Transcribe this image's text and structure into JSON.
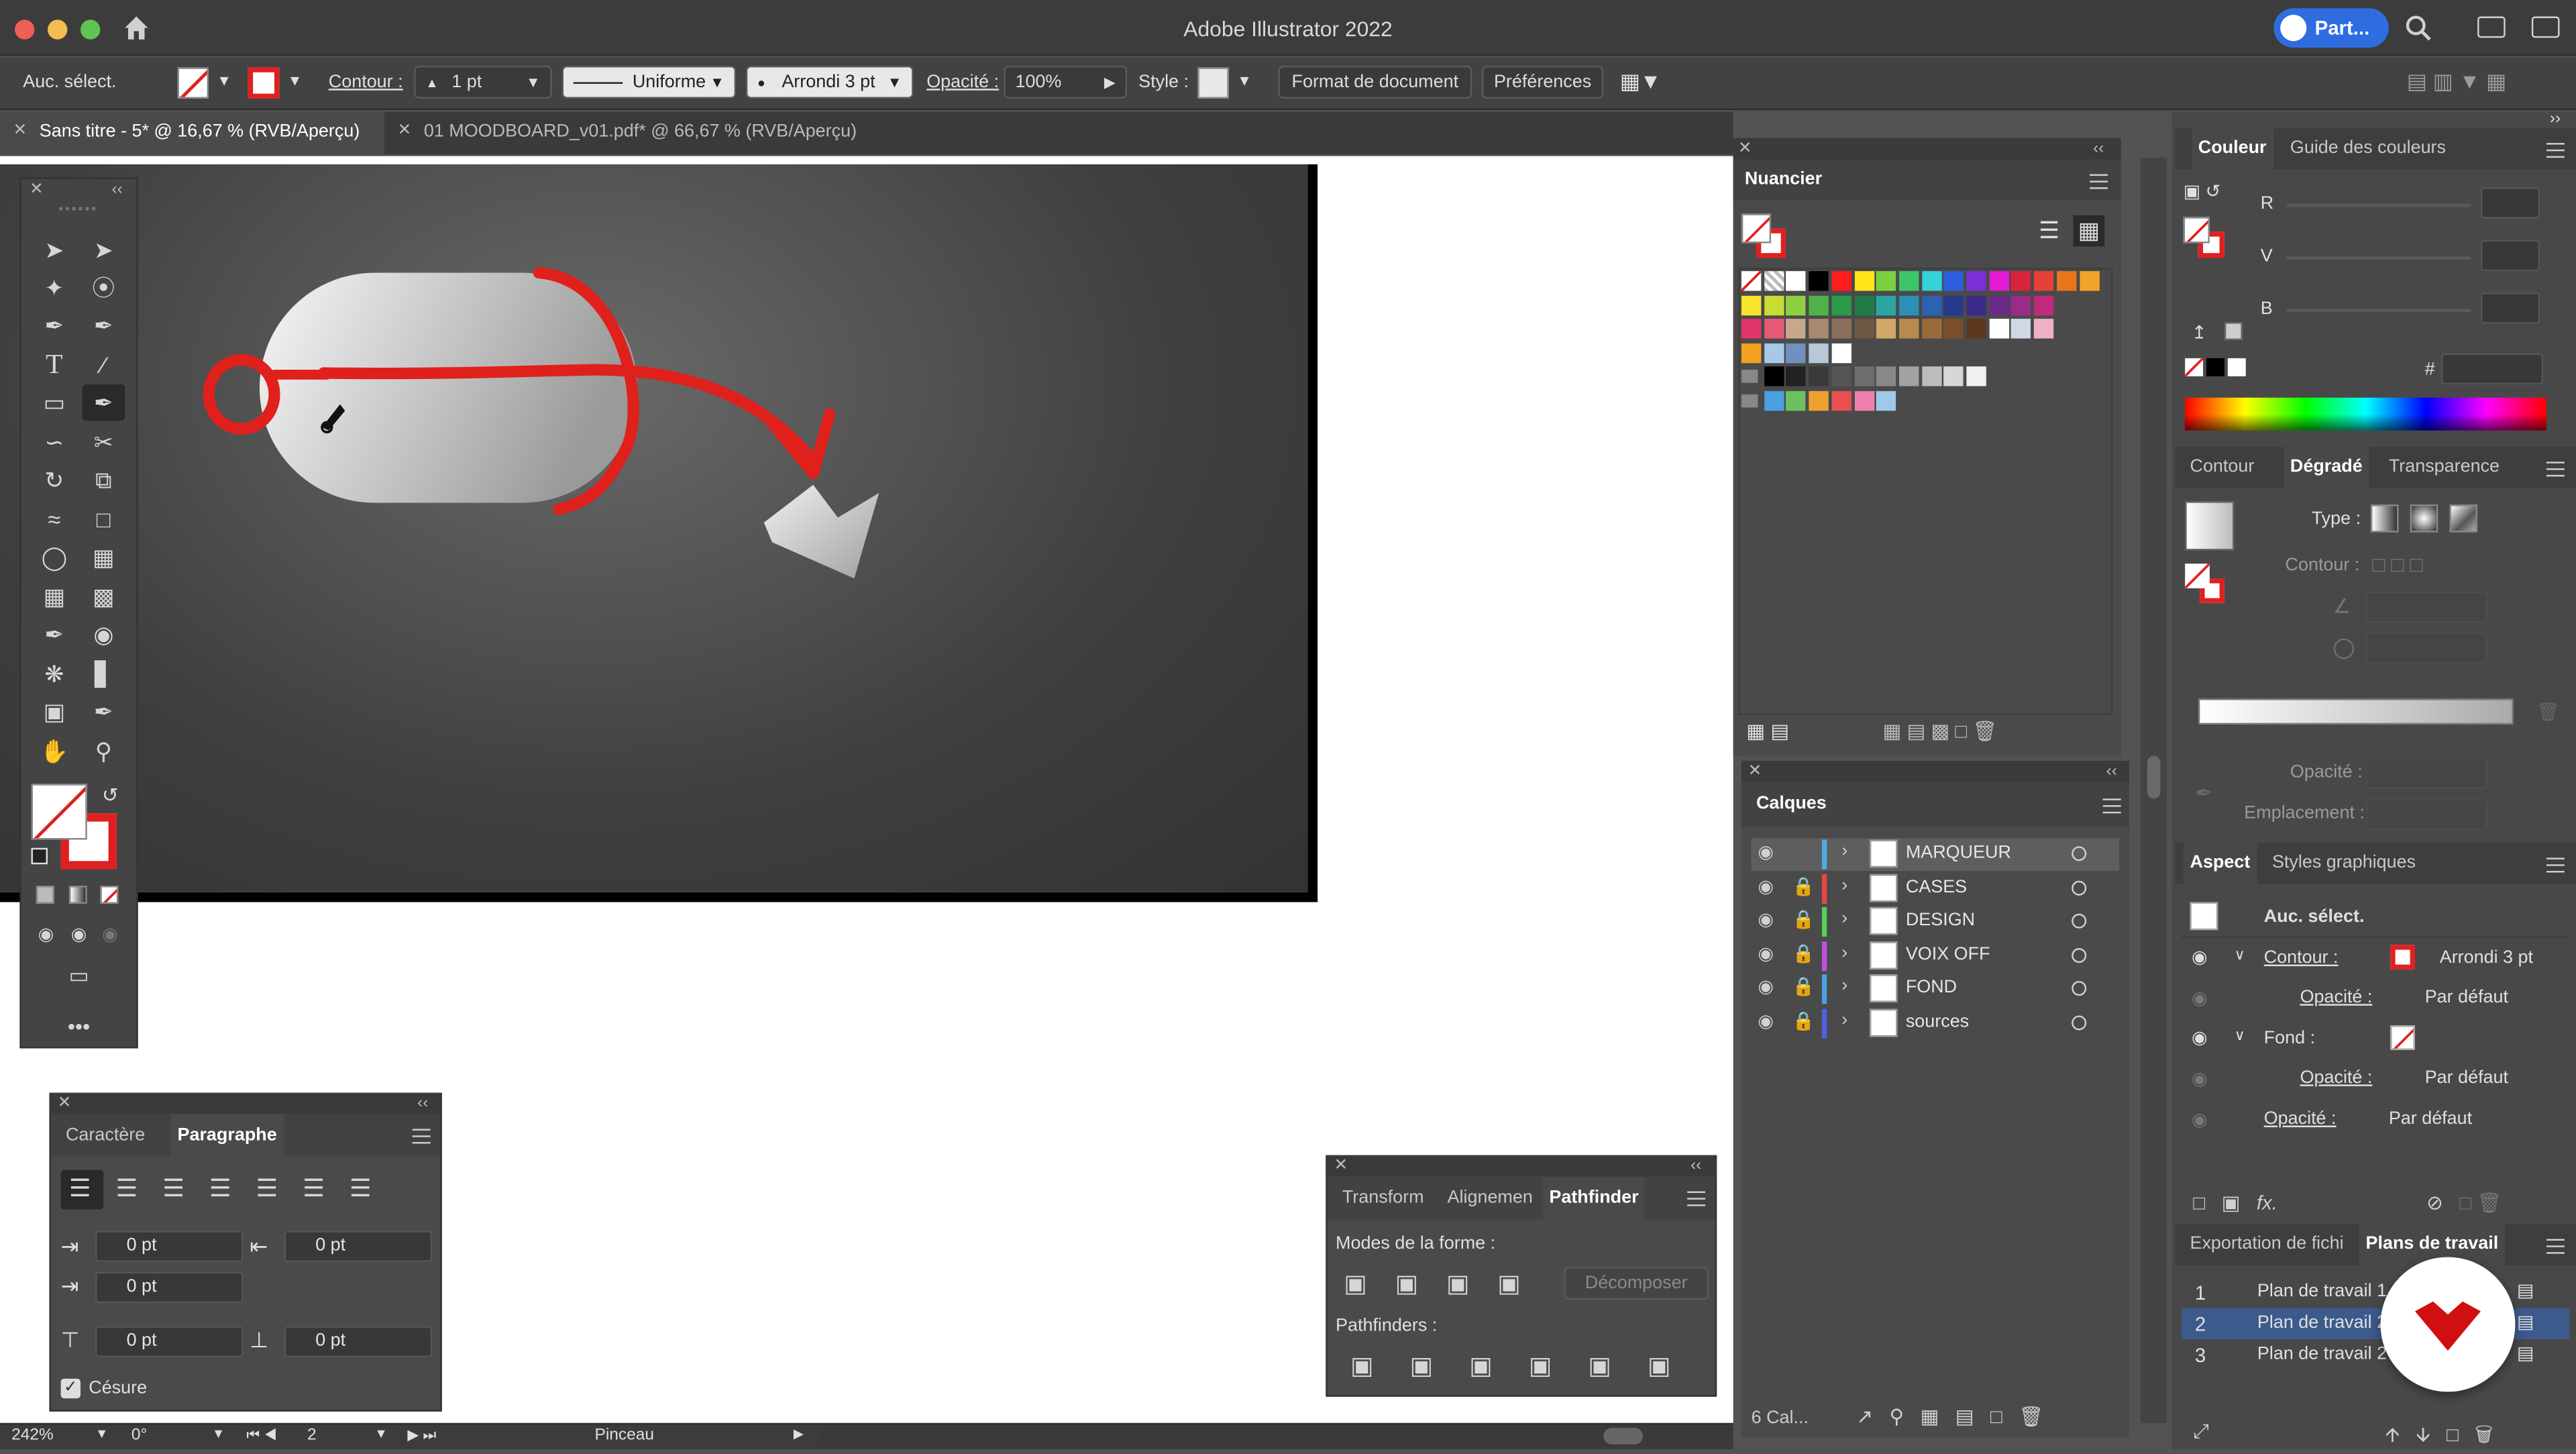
{
  "app": {
    "title": "Adobe Illustrator 2022",
    "share": "Part..."
  },
  "control": {
    "selection": "Auc. sélect.",
    "stroke_label": "Contour :",
    "stroke_weight": "1 pt",
    "profile": "Uniforme",
    "brush": "Arrondi 3 pt",
    "opacity_label": "Opacité :",
    "opacity": "100%",
    "style_label": "Style :",
    "doc_setup": "Format de document",
    "prefs": "Préférences"
  },
  "tabs": [
    {
      "label": "Sans titre - 5* @ 16,67 % (RVB/Aperçu)"
    },
    {
      "label": "01 MOODBOARD_v01.pdf* @ 66,67 % (RVB/Aperçu)"
    }
  ],
  "swatches": {
    "title": "Nuancier"
  },
  "layers": {
    "title": "Calques",
    "items": [
      {
        "name": "MARQUEUR",
        "color": "#4fa9e8"
      },
      {
        "name": "CASES",
        "color": "#e84646"
      },
      {
        "name": "DESIGN",
        "color": "#58d05a"
      },
      {
        "name": "VOIX OFF",
        "color": "#c050e0"
      },
      {
        "name": "FOND",
        "color": "#4aa0e0"
      },
      {
        "name": "sources",
        "color": "#5060e0"
      }
    ],
    "count": "6 Cal..."
  },
  "color": {
    "tabs": [
      "Couleur",
      "Guide des couleurs"
    ],
    "channels": [
      "R",
      "V",
      "B"
    ],
    "hash": "#"
  },
  "gradient": {
    "tabs": [
      "Contour",
      "Dégradé",
      "Transparence"
    ],
    "type_label": "Type :",
    "stroke_label": "Contour :",
    "opacity_label": "Opacité :",
    "location_label": "Emplacement :"
  },
  "appearance": {
    "tabs": [
      "Aspect",
      "Styles graphiques"
    ],
    "selection": "Auc. sélect.",
    "stroke_label": "Contour :",
    "stroke_value": "Arrondi 3 pt",
    "opacity_label": "Opacité :",
    "opacity_value": "Par défaut",
    "fill_label": "Fond :",
    "opacity2_label": "Opacité :",
    "opacity2_value": "Par défaut",
    "opacity3_label": "Opacité :",
    "opacity3_value": "Par défaut"
  },
  "artboards": {
    "tabs": [
      "Exportation de fichi",
      "Plans de travail"
    ],
    "items": [
      {
        "num": "1",
        "name": "Plan de travail 1"
      },
      {
        "num": "2",
        "name": "Plan de travail 2"
      },
      {
        "num": "3",
        "name": "Plan de travail 2"
      }
    ]
  },
  "paragraph": {
    "tabs": [
      "Caractère",
      "Paragraphe"
    ],
    "left_indent": "0 pt",
    "right_indent": "0 pt",
    "first_indent": "0 pt",
    "space_before": "0 pt",
    "space_after": "0 pt",
    "hyphenate": "Césure"
  },
  "pathfinder": {
    "tabs": [
      "Transform",
      "Alignemen",
      "Pathfinder"
    ],
    "shape_modes": "Modes de la forme :",
    "expand": "Décomposer",
    "pathfinders": "Pathfinders :"
  },
  "status": {
    "zoom": "242%",
    "rotation": "0°",
    "artboard": "2",
    "tool": "Pinceau"
  }
}
